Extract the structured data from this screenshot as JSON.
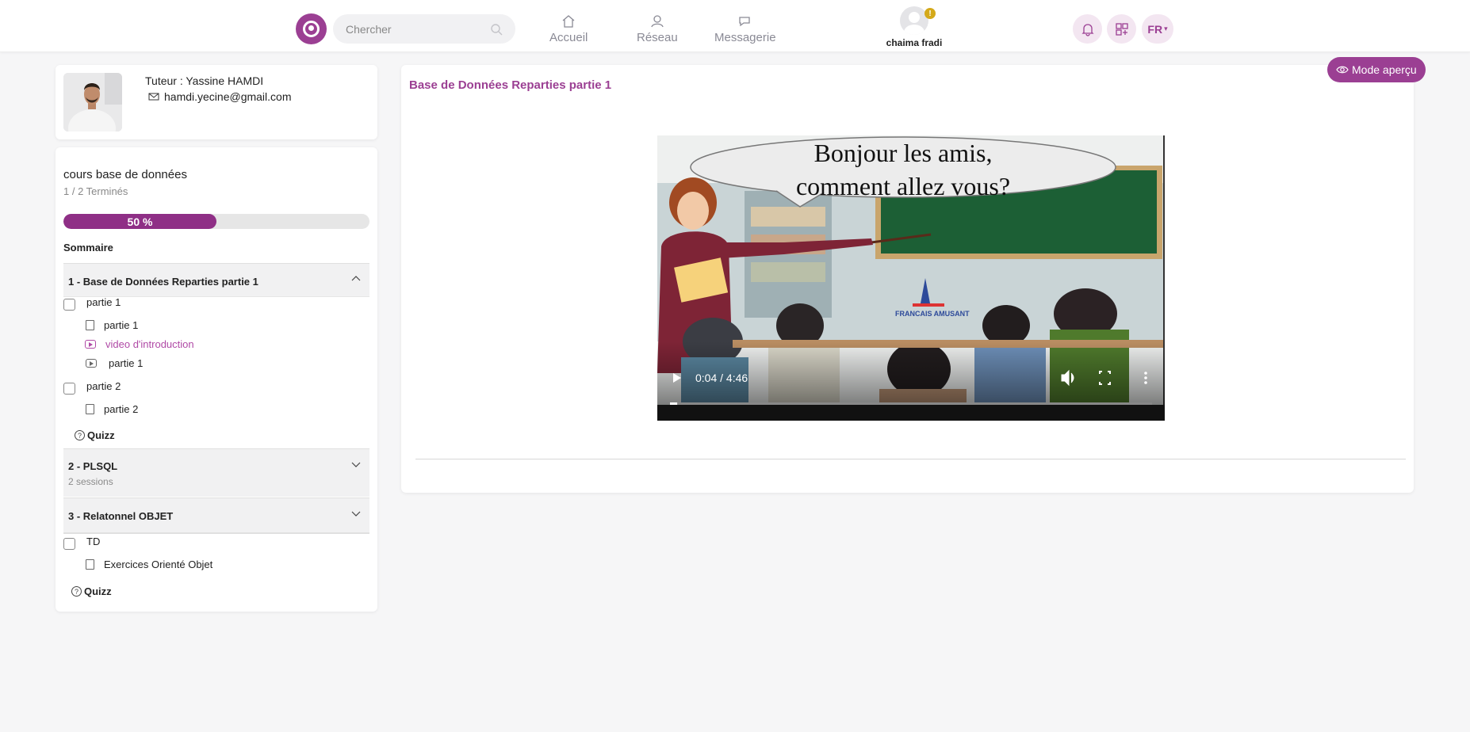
{
  "header": {
    "search_placeholder": "Chercher",
    "nav": [
      {
        "label": "Accueil"
      },
      {
        "label": "Réseau"
      },
      {
        "label": "Messagerie"
      }
    ],
    "user_name": "chaima fradi",
    "user_badge": "!",
    "language": "FR"
  },
  "tutor": {
    "name": "Tuteur : Yassine HAMDI",
    "email": "hamdi.yecine@gmail.com"
  },
  "course": {
    "title": "cours base de données",
    "completed": "1 / 2 Terminés",
    "progress_label": "50 %",
    "progress_value": 0.5,
    "summary_label": "Sommaire",
    "sections": [
      {
        "title": "1 - Base de Données Reparties partie 1",
        "items": [
          {
            "label": "partie 1"
          },
          {
            "label": "partie 1"
          },
          {
            "label": "video d'introduction"
          },
          {
            "label": "partie 1"
          },
          {
            "label": "partie 2"
          },
          {
            "label": "partie 2"
          }
        ],
        "quiz": "Quizz"
      },
      {
        "title": "2 - PLSQL",
        "subtitle": "2 sessions"
      },
      {
        "title": "3 - Relatonnel OBJET",
        "items": [
          {
            "label": "TD"
          },
          {
            "label": "Exercices Orienté Objet"
          }
        ],
        "quiz": "Quizz"
      }
    ]
  },
  "main": {
    "lesson_title": "Base de Données Reparties partie 1",
    "mode_button": "Mode aperçu",
    "video": {
      "speech_line1": "Bonjour les amis,",
      "speech_line2": "comment allez vous?",
      "brand": "FRANCAIS AMUSANT",
      "time": "0:04 / 4:46",
      "progress_value": 0.015
    }
  },
  "colors": {
    "brand": "#9b3f93",
    "progress": "#8f2f86"
  }
}
